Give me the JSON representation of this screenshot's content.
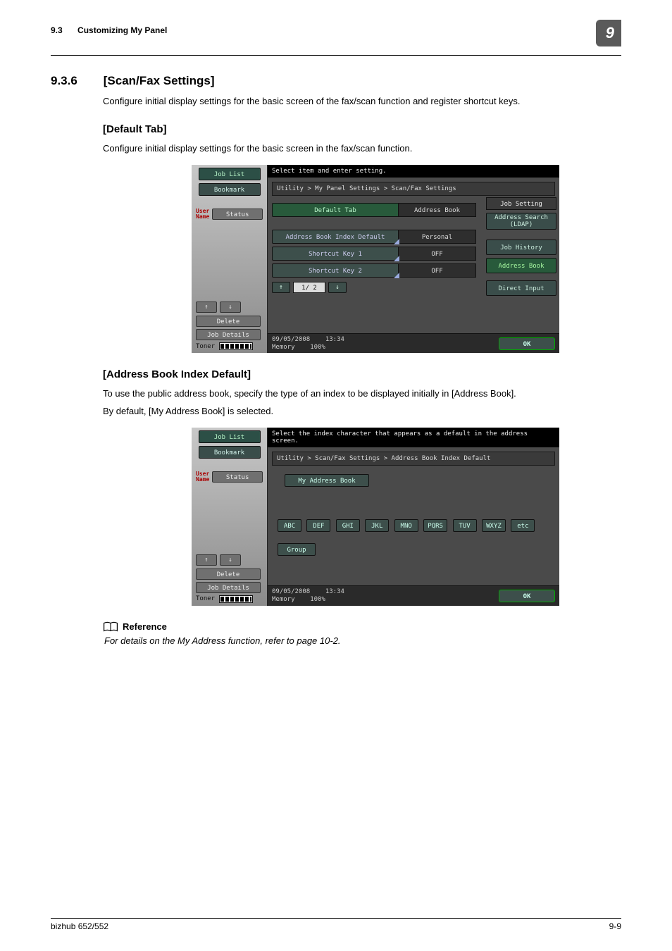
{
  "header": {
    "section_num": "9.3",
    "section_title": "Customizing My Panel",
    "chapter": "9"
  },
  "sec936": {
    "num": "9.3.6",
    "title": "[Scan/Fax Settings]",
    "intro": "Configure initial display settings for the basic screen of the fax/scan function and register shortcut keys."
  },
  "default_tab": {
    "heading": "[Default Tab]",
    "intro": "Configure initial display settings for the basic screen in the fax/scan function."
  },
  "abid": {
    "heading": "[Address Book Index Default]",
    "p1": "To use the public address book, specify the type of an index to be displayed initially in [Address Book].",
    "p2": "By default, [My Address Book] is selected."
  },
  "reference": {
    "label": "Reference",
    "text": "For details on the My Address function, refer to page 10-2."
  },
  "footer": {
    "left": "bizhub 652/552",
    "right": "9-9"
  },
  "panel_common": {
    "job_list": "Job List",
    "bookmark": "Bookmark",
    "user_label": "User\nName",
    "status": "Status",
    "delete": "Delete",
    "job_details": "Job Details",
    "toner": "Toner",
    "date": "09/05/2008",
    "time": "13:34",
    "memory_label": "Memory",
    "memory_val": "100%",
    "ok": "OK",
    "arrow_up": "↑",
    "arrow_down": "↓"
  },
  "panel1": {
    "msg": "Select item and enter setting.",
    "crumb": "Utility > My Panel Settings > Scan/Fax Settings",
    "rows": {
      "default_tab_k": "Default Tab",
      "default_tab_v": "Address Book",
      "abid_k": "Address Book Index Default",
      "abid_v": "Personal",
      "sk1_k": "Shortcut Key 1",
      "sk1_v": "OFF",
      "sk2_k": "Shortcut Key 2",
      "sk2_v": "OFF"
    },
    "page_ind": "1/ 2",
    "side": {
      "head": "Job Setting",
      "b1": "Address Search\n(LDAP)",
      "b2": "Job History",
      "b3": "Address Book",
      "b4": "Direct Input"
    }
  },
  "panel2": {
    "msg": "Select the index character that appears as a default in the address screen.",
    "crumb": "Utility > Scan/Fax Settings > Address Book Index Default",
    "my_addr": "My Address Book",
    "idx": [
      "ABC",
      "DEF",
      "GHI",
      "JKL",
      "MNO",
      "PQRS",
      "TUV",
      "WXYZ",
      "etc"
    ],
    "group": "Group"
  }
}
